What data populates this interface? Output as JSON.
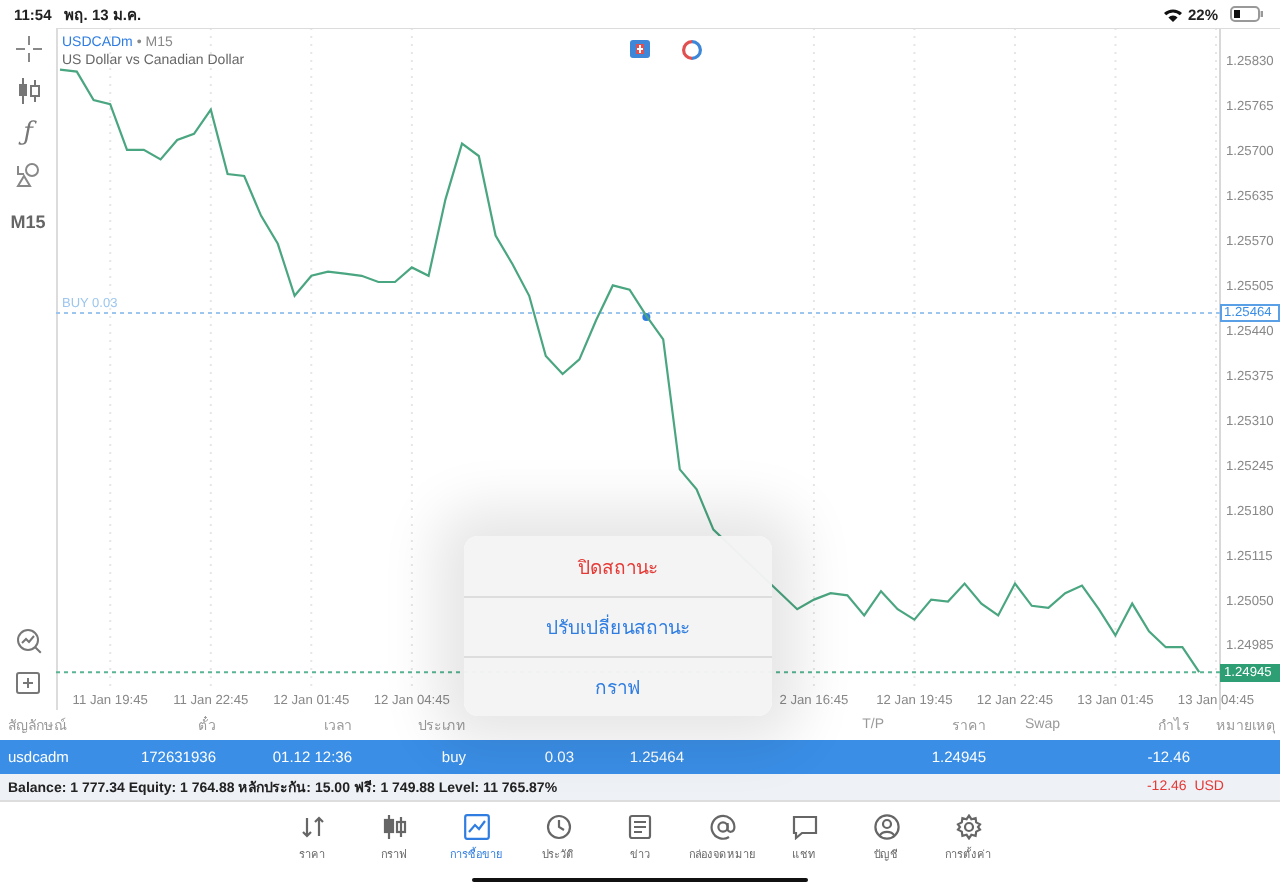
{
  "status_bar": {
    "time": "11:54",
    "date": "พฤ. 13 ม.ค.",
    "battery": "22%"
  },
  "toolbar": {
    "indicator_glyph": "ƒ",
    "timeframe": "M15"
  },
  "chart": {
    "symbol": "USDCADm",
    "timeframe": "• M15",
    "description": "US Dollar vs Canadian Dollar",
    "price_tags": [
      {
        "kind": "order",
        "label": "1.25464"
      },
      {
        "kind": "bid",
        "label": "1.24945"
      }
    ],
    "chart_data": {
      "type": "line",
      "grid": true,
      "categories": [
        null,
        null,
        null,
        "11 Jan 19:45",
        null,
        null,
        null,
        null,
        null,
        "11 Jan 22:45",
        null,
        null,
        null,
        null,
        null,
        "12 Jan 01:45",
        null,
        null,
        null,
        null,
        null,
        "12 Jan 04:45",
        null,
        null,
        null,
        null,
        null,
        null,
        null,
        null,
        null,
        null,
        null,
        null,
        null,
        null,
        null,
        null,
        null,
        null,
        null,
        null,
        null,
        null,
        null,
        "2 Jan 16:45",
        null,
        null,
        null,
        null,
        null,
        "12 Jan 19:45",
        null,
        null,
        null,
        null,
        null,
        "12 Jan 22:45",
        null,
        null,
        null,
        null,
        null,
        "13 Jan 01:45",
        null,
        null,
        null,
        null,
        null,
        "13 Jan 04:45"
      ],
      "series": [
        {
          "color": "#4aa680",
          "values": [
            1.25816,
            1.25813,
            1.25772,
            1.25766,
            1.257,
            1.257,
            1.25686,
            1.25714,
            1.25723,
            1.25758,
            1.25665,
            1.25662,
            1.25605,
            1.25564,
            1.25489,
            1.25518,
            1.25524,
            1.25521,
            1.25518,
            1.25509,
            1.25509,
            1.2553,
            1.25518,
            1.25628,
            1.25709,
            1.25691,
            1.25576,
            1.25535,
            1.25489,
            1.25402,
            1.25376,
            1.25397,
            1.25454,
            1.25504,
            1.25498,
            1.2546,
            1.25426,
            1.25238,
            1.25209,
            1.25151,
            null,
            null,
            null,
            null,
            1.25036,
            1.2505,
            1.25059,
            1.25056,
            1.25027,
            1.25062,
            1.25036,
            1.25021,
            1.2505,
            1.25047,
            1.25073,
            1.25044,
            1.25027,
            1.25073,
            1.25041,
            1.25038,
            1.25059,
            1.2507,
            1.25036,
            1.24998,
            1.25044,
            1.25004,
            1.24981,
            1.24981,
            1.24945,
            null
          ]
        }
      ],
      "ylim": [
        1.24925,
        1.25876
      ],
      "yticks": [
        {
          "value": 1.2583,
          "label": "1.25830"
        },
        {
          "value": 1.25765,
          "label": "1.25765"
        },
        {
          "value": 1.257,
          "label": "1.25700"
        },
        {
          "value": 1.25635,
          "label": "1.25635"
        },
        {
          "value": 1.2557,
          "label": "1.25570"
        },
        {
          "value": 1.25505,
          "label": "1.25505"
        },
        {
          "value": 1.2544,
          "label": "1.25440"
        },
        {
          "value": 1.25375,
          "label": "1.25375"
        },
        {
          "value": 1.2531,
          "label": "1.25310"
        },
        {
          "value": 1.25245,
          "label": "1.25245"
        },
        {
          "value": 1.2518,
          "label": "1.25180"
        },
        {
          "value": 1.25115,
          "label": "1.25115"
        },
        {
          "value": 1.2505,
          "label": "1.25050"
        },
        {
          "value": 1.24985,
          "label": "1.24985"
        }
      ],
      "ref_lines": [
        {
          "axis": "y",
          "value": 1.25464,
          "label": "BUY 0.03",
          "color": "#9cc6ee"
        },
        {
          "axis": "y",
          "value": 1.24945,
          "color": "#59b592"
        }
      ]
    }
  },
  "popup": {
    "items": [
      {
        "label": "ปิดสถานะ",
        "kind": "destructive"
      },
      {
        "label": "ปรับเปลี่ยนสถานะ",
        "kind": "default"
      },
      {
        "label": "กราฟ",
        "kind": "default"
      }
    ]
  },
  "trades": {
    "columns": [
      "สัญลักษณ์",
      "ตั๋ว",
      "เวลา",
      "ประเภท",
      "T/P",
      "ราคา",
      "Swap",
      "กำไร",
      "หมายเหตุ"
    ],
    "rows": [
      {
        "symbol": "usdcadm",
        "ticket": "172631936",
        "time": "01.12 12:36",
        "type": "buy",
        "volume": "0.03",
        "open_price": "1.25464",
        "price": "1.24945",
        "profit": "-12.46",
        "selected": true
      }
    ]
  },
  "account": {
    "summary": "Balance: 1 777.34 Equity: 1 764.88 หลักประกัน: 15.00 ฟรี: 1 749.88 Level: 11 765.87%",
    "total": "-12.46  USD"
  },
  "nav": [
    {
      "label": "ราคา",
      "selected": false
    },
    {
      "label": "กราฟ",
      "selected": false
    },
    {
      "label": "การซื้อขาย",
      "selected": true
    },
    {
      "label": "ประวัติ",
      "selected": false
    },
    {
      "label": "ข่าว",
      "selected": false
    },
    {
      "label": "กล่องจดหมาย",
      "selected": false
    },
    {
      "label": "แชท",
      "selected": false
    },
    {
      "label": "บัญชี",
      "selected": false
    },
    {
      "label": "การตั้งค่า",
      "selected": false
    }
  ]
}
